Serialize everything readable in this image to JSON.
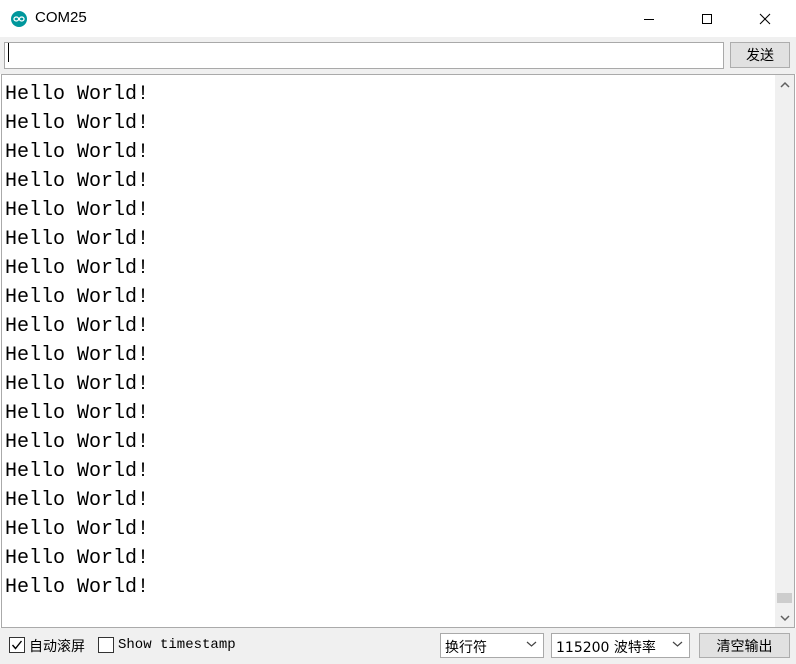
{
  "window": {
    "title": "COM25",
    "icon": "arduino-infinity-icon",
    "accent": "#00979c"
  },
  "send_bar": {
    "input_value": "",
    "send_label": "发送"
  },
  "output": {
    "lines": [
      "Hello World!",
      "Hello World!",
      "Hello World!",
      "Hello World!",
      "Hello World!",
      "Hello World!",
      "Hello World!",
      "Hello World!",
      "Hello World!",
      "Hello World!",
      "Hello World!",
      "Hello World!",
      "Hello World!",
      "Hello World!",
      "Hello World!",
      "Hello World!",
      "Hello World!",
      "Hello World!"
    ]
  },
  "bottom_bar": {
    "autoscroll_label": "自动滚屏",
    "autoscroll_checked": true,
    "timestamp_label": "Show timestamp",
    "timestamp_checked": false,
    "line_ending_value": "换行符",
    "baud_rate_value": "115200 波特率",
    "clear_label": "清空输出"
  }
}
